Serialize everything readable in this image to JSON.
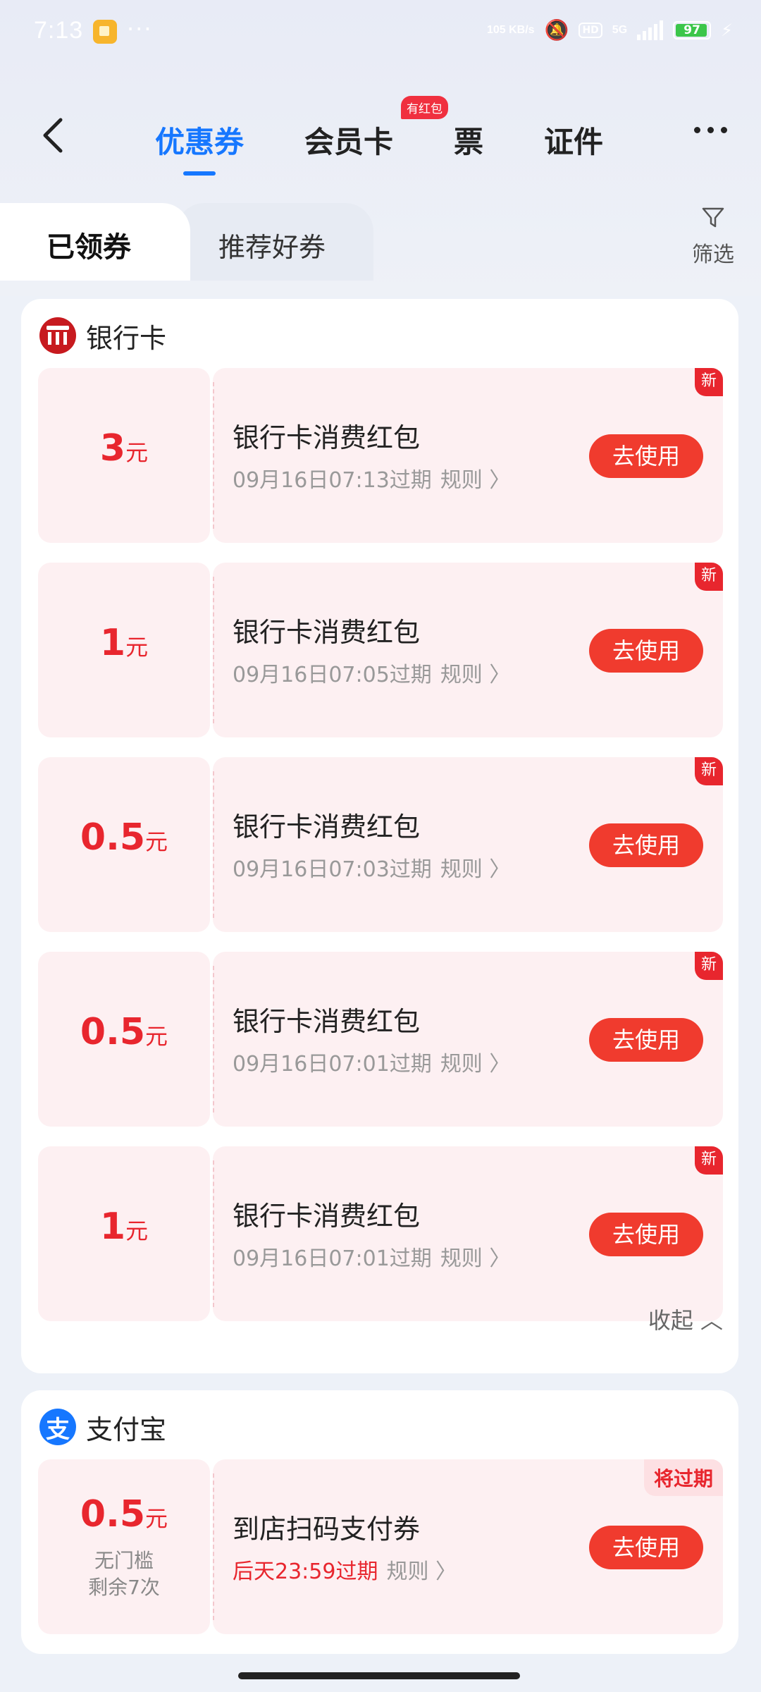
{
  "status_bar": {
    "time": "7:13",
    "more": "···",
    "speed": "105 KB/s",
    "network": "5G",
    "hd": "HD",
    "battery": "97"
  },
  "header": {
    "tabs": [
      {
        "label": "优惠券",
        "active": true
      },
      {
        "label": "会员卡",
        "badge": "有红包"
      },
      {
        "label": "票"
      },
      {
        "label": "证件"
      }
    ]
  },
  "subtabs": {
    "active": "已领券",
    "inactive": "推荐好券",
    "filter_label": "筛选"
  },
  "bank_section": {
    "title": "银行卡",
    "coupons": [
      {
        "amount": "3",
        "unit": "元",
        "name": "银行卡消费红包",
        "expire": "09月16日07:13过期",
        "rules": "规则 〉",
        "button": "去使用",
        "tag": "新"
      },
      {
        "amount": "1",
        "unit": "元",
        "name": "银行卡消费红包",
        "expire": "09月16日07:05过期",
        "rules": "规则 〉",
        "button": "去使用",
        "tag": "新"
      },
      {
        "amount": "0.5",
        "unit": "元",
        "name": "银行卡消费红包",
        "expire": "09月16日07:03过期",
        "rules": "规则 〉",
        "button": "去使用",
        "tag": "新"
      },
      {
        "amount": "0.5",
        "unit": "元",
        "name": "银行卡消费红包",
        "expire": "09月16日07:01过期",
        "rules": "规则 〉",
        "button": "去使用",
        "tag": "新"
      },
      {
        "amount": "1",
        "unit": "元",
        "name": "银行卡消费红包",
        "expire": "09月16日07:01过期",
        "rules": "规则 〉",
        "button": "去使用",
        "tag": "新"
      }
    ],
    "collapse_label": "收起 ︿"
  },
  "alipay_section": {
    "title": "支付宝",
    "icon_glyph": "支",
    "coupon": {
      "amount": "0.5",
      "unit": "元",
      "condition": "无门槛",
      "remaining": "剩余7次",
      "name": "到店扫码支付券",
      "expire": "后天23:59过期",
      "rules": "规则 〉",
      "button": "去使用",
      "tag": "将过期"
    }
  },
  "colors": {
    "accent_blue": "#1677ff",
    "coupon_red": "#e8262e",
    "button_red": "#f03b2e",
    "coupon_bg": "#fdf0f2"
  }
}
